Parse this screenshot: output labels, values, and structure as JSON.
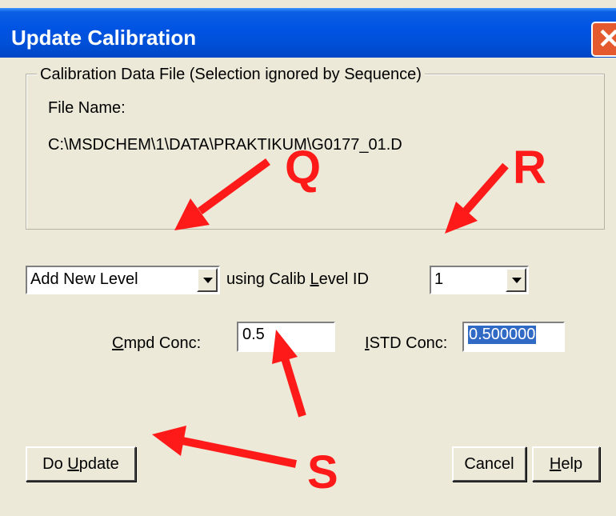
{
  "dialog": {
    "title": "Update Calibration",
    "close_glyph": "✕"
  },
  "calibration_group": {
    "legend": "Calibration Data File (Selection ignored by Sequence)",
    "file_name_label": "File Name:",
    "file_path": "C:\\MSDCHEM\\1\\DATA\\PRAKTIKUM\\G0177_01.D"
  },
  "level_row": {
    "mode_value": "Add New Level",
    "using_label": "using Calib Level ID",
    "level_id_value": "1"
  },
  "conc_row": {
    "cmpd_label": "Cmpd Conc:",
    "cmpd_value": "0.5",
    "istd_label": "ISTD Conc:",
    "istd_value": "0.500000"
  },
  "buttons": {
    "do_update": "Do Update",
    "cancel": "Cancel",
    "help": "Help"
  },
  "annotations": {
    "q": "Q",
    "r": "R",
    "s": "S",
    "color": "#ff1a1a"
  }
}
